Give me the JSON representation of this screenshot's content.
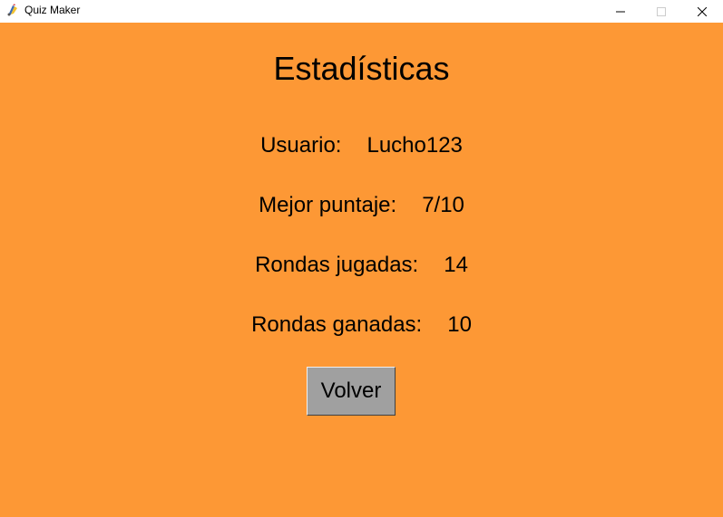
{
  "window": {
    "title": "Quiz Maker",
    "app_icon": "python-feather-icon",
    "controls": {
      "minimize_icon": "minimize-icon",
      "maximize_icon": "maximize-icon",
      "close_icon": "close-icon"
    }
  },
  "colors": {
    "background": "#fd9835",
    "button": "#a0a0a0",
    "text": "#000000"
  },
  "stats": {
    "heading": "Estadísticas",
    "user": {
      "label": "Usuario:",
      "value": "Lucho123"
    },
    "best_score": {
      "label": "Mejor puntaje:",
      "value": "7/10"
    },
    "rounds_played": {
      "label": "Rondas jugadas:",
      "value": "14"
    },
    "rounds_won": {
      "label": "Rondas ganadas:",
      "value": "10"
    }
  },
  "actions": {
    "back_label": "Volver"
  }
}
